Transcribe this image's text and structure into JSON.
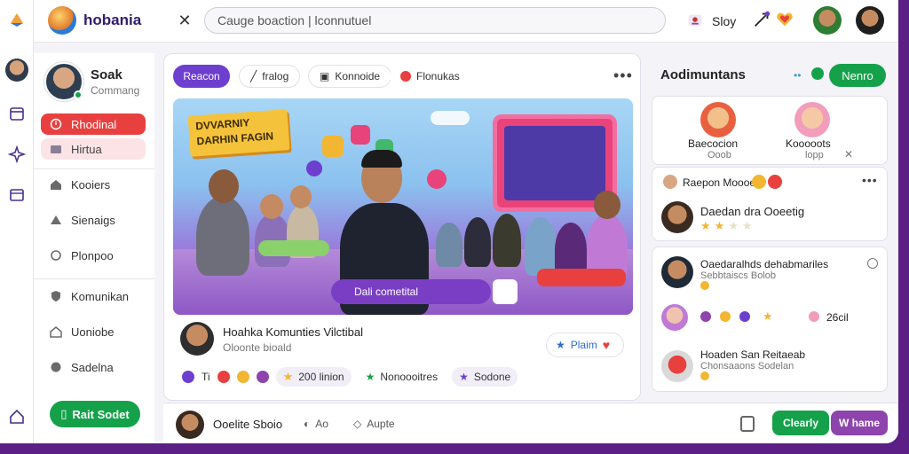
{
  "topbar": {
    "brand": "hobania",
    "search_value": "Cauge boaction | lconnutuel",
    "user_label": "Sloy"
  },
  "sidebar": {
    "profile_name": "Soak",
    "profile_sub": "Commang",
    "items": [
      {
        "label": "Rhodinal",
        "state": "active"
      },
      {
        "label": "Hirtua",
        "state": "soft"
      },
      {
        "label": "Kooiers",
        "state": "normal"
      },
      {
        "label": "Sienaigs",
        "state": "normal"
      },
      {
        "label": "Plonpoo",
        "state": "normal"
      },
      {
        "label": "Komunikan",
        "state": "normal"
      },
      {
        "label": "Uoniobe",
        "state": "normal"
      },
      {
        "label": "Sadelna",
        "state": "normal"
      }
    ],
    "cta": "Rait Sodet"
  },
  "main": {
    "tabs": [
      "Reacon",
      "fralog",
      "Konnoide",
      "Flonukas"
    ],
    "hero": {
      "sign_text": "DVVARNIY DARHIN FAGIN",
      "banner_text": "Dali cometital"
    },
    "post": {
      "title": "Hoahka Komunties Vilctibal",
      "subtitle": "Oloonte bioald",
      "action": "Plaim"
    },
    "reactions": {
      "count_a": "Ti",
      "pill_1": "200 linion",
      "pill_2": "Nonoooitres",
      "pill_3": "Sodone"
    }
  },
  "composer": {
    "name": "Ooelite Sboio",
    "act_1": "Ao",
    "act_2": "Aupte",
    "btn_green": "Clearly",
    "btn_purple": "W hame"
  },
  "right": {
    "title": "Aodimuntans",
    "join": "Nenro",
    "suggest": [
      {
        "name": "Baecocion",
        "sub": "Ooob"
      },
      {
        "name": "Kooooots",
        "sub": "lopp"
      }
    ],
    "rows": [
      {
        "title": "Raepon Moooes"
      },
      {
        "title": "Daedan dra Ooeetig"
      },
      {
        "title": "Oaedaralhds dehabmariles",
        "sub": "Sebbtaiscs Bolob"
      },
      {
        "title": "",
        "value": "26cil"
      },
      {
        "title": "Hoaden San Reitaeab",
        "sub": "Chonsaaons Sodelan"
      }
    ]
  },
  "colors": {
    "accent_purple": "#6d3fcf",
    "accent_green": "#15a14a",
    "accent_red": "#e8403f",
    "frame_bg": "#5b1f86"
  }
}
